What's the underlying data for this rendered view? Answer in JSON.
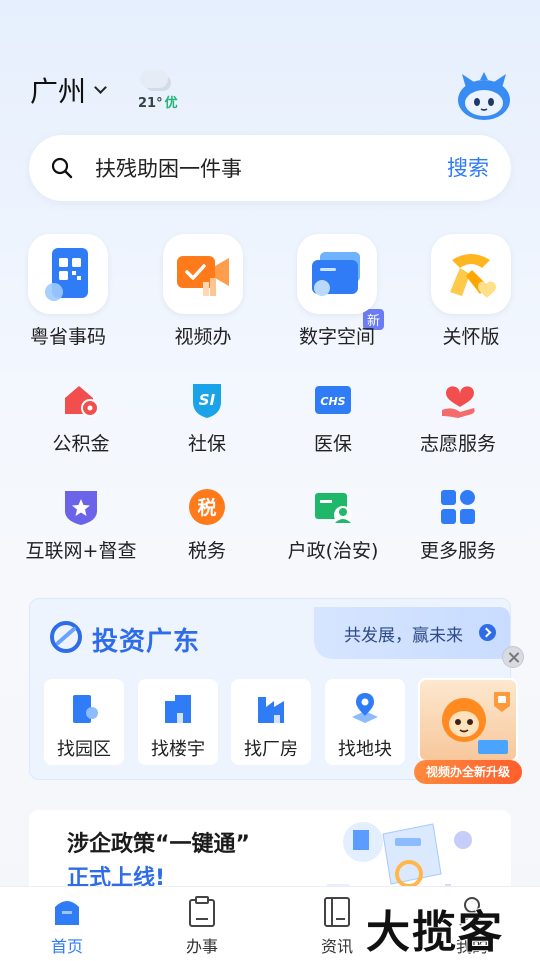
{
  "header": {
    "city": "广州",
    "weather_temp": "21°",
    "air_quality": "优"
  },
  "search": {
    "query_text": "扶残助困一件事",
    "new_tag": "新",
    "button_label": "搜索"
  },
  "top_services": [
    {
      "label": "粤省事码",
      "icon": "qr-card-icon"
    },
    {
      "label": "视频办",
      "icon": "video-camera-icon"
    },
    {
      "label": "数字空间",
      "icon": "folder-cards-icon"
    },
    {
      "label": "关怀版",
      "icon": "care-scarf-icon"
    }
  ],
  "services": [
    {
      "label": "公积金",
      "icon": "house-fund-icon"
    },
    {
      "label": "社保",
      "icon": "social-security-icon"
    },
    {
      "label": "医保",
      "icon": "medical-insurance-icon"
    },
    {
      "label": "志愿服务",
      "icon": "volunteer-heart-icon"
    },
    {
      "label": "互联网+督查",
      "icon": "star-shield-icon"
    },
    {
      "label": "税务",
      "icon": "tax-icon"
    },
    {
      "label": "户政(治安)",
      "icon": "household-id-icon"
    },
    {
      "label": "更多服务",
      "icon": "grid-more-icon"
    }
  ],
  "invest": {
    "title": "投资广东",
    "slogan": "共发展，赢未来",
    "items": [
      "找园区",
      "找楼宇",
      "找厂房",
      "找地块"
    ]
  },
  "video_popup": {
    "banner": "视频办全新升级"
  },
  "policy": {
    "line1": "涉企政策“一键通”",
    "line2": "正式上线!"
  },
  "bottom_nav": [
    {
      "label": "首页",
      "active": true
    },
    {
      "label": "办事",
      "active": false
    },
    {
      "label": "资讯",
      "active": false
    },
    {
      "label": "我的",
      "active": false
    }
  ],
  "watermark": "大揽客",
  "colors": {
    "accent": "#2f7cf6",
    "invest_title": "#2f6de8",
    "air_quality_good": "#22b573"
  }
}
